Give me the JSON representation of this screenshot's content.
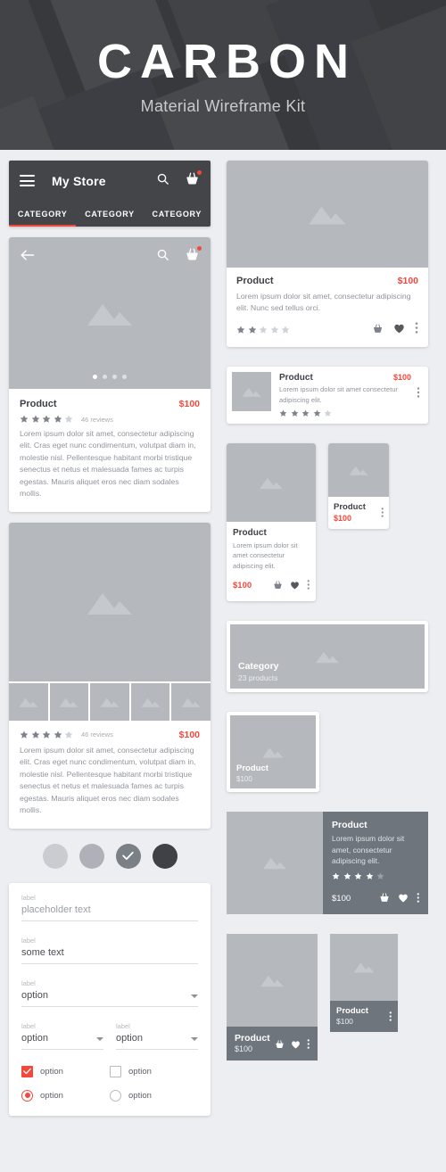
{
  "hero": {
    "title": "CARBON",
    "subtitle": "Material Wireframe Kit"
  },
  "colors": {
    "accent_red": "#f4483d",
    "appbar_dark": "#434549",
    "placeholder_gray": "#b5b8bd",
    "panel_gray": "#6e757c",
    "page_bg": "#edeef2"
  },
  "appbar": {
    "title": "My Store",
    "menu_icon": "hamburger-icon",
    "search_icon": "search-icon",
    "cart_icon": "cart-icon",
    "tabs": [
      {
        "label": "CATEGORY",
        "active": true
      },
      {
        "label": "CATEGORY",
        "active": false
      },
      {
        "label": "CATEGORY",
        "active": false
      }
    ]
  },
  "detail_card": {
    "back_icon": "back-arrow-icon",
    "search_icon": "search-icon",
    "cart_icon": "cart-icon",
    "carousel_dots": 4,
    "carousel_active": 1,
    "name": "Product",
    "price": "$100",
    "rating": 4,
    "reviews": "46 reviews",
    "description": "Lorem ipsum dolor sit amet, consectetur adipiscing elit. Cras eget nunc condimentum, volutpat diam in, molestie nisl. Pellentesque habitant morbi tristique senectus et netus et malesuada fames ac turpis egestas. Mauris aliquet eros nec diam sodales mollis."
  },
  "gallery_card": {
    "thumbnail_count": 5,
    "rating": 4,
    "reviews": "46 reviews",
    "price": "$100",
    "description": "Lorem ipsum dolor sit amet, consectetur adipiscing elit. Cras eget nunc condimentum, volutpat diam in, molestie nisl. Pellentesque habitant morbi tristique senectus et netus et malesuada fames ac turpis egestas. Mauris aliquet eros nec diam sodales mollis."
  },
  "swatches": [
    {
      "name": "swatch-lightest",
      "color": "#c9ccd1",
      "selected": false
    },
    {
      "name": "swatch-light",
      "color": "#aeb2b8",
      "selected": false
    },
    {
      "name": "swatch-medium",
      "color": "#7b7f86",
      "selected": true
    },
    {
      "name": "swatch-dark",
      "color": "#3e4146",
      "selected": false
    }
  ],
  "form": {
    "text_field": {
      "label": "label",
      "value": "placeholder text",
      "is_placeholder": true
    },
    "text_field_filled": {
      "label": "label",
      "value": "some text",
      "is_placeholder": false
    },
    "select_full": {
      "label": "label",
      "value": "option"
    },
    "select_left": {
      "label": "label",
      "value": "option"
    },
    "select_right": {
      "label": "label",
      "value": "option"
    },
    "checkbox_checked": {
      "label": "option",
      "checked": true
    },
    "checkbox_unchecked": {
      "label": "option",
      "checked": false
    },
    "radio_selected": {
      "label": "option",
      "selected": true
    },
    "radio_unselected": {
      "label": "option",
      "selected": false
    }
  },
  "right_column": {
    "card_full": {
      "name": "Product",
      "price": "$100",
      "description": "Lorem ipsum dolor sit amet, consectetur adipiscing elit. Nunc sed tellus orci.",
      "rating": 2,
      "actions": [
        "cart-icon",
        "heart-icon",
        "overflow-menu-icon"
      ]
    },
    "card_list": {
      "name": "Product",
      "price": "$100",
      "description": "Lorem ipsum dolor sit amet consectetur adipiscing elit.",
      "rating": 4,
      "actions": [
        "overflow-menu-icon"
      ]
    },
    "card_grid_large": {
      "name": "Product",
      "price": "$100",
      "description": "Lorem ipsum dolor sit amet consectetur adipiscing elit.",
      "actions": [
        "cart-icon",
        "heart-icon",
        "overflow-menu-icon"
      ]
    },
    "card_grid_small": {
      "name": "Product",
      "price": "$100",
      "actions": [
        "overflow-menu-icon"
      ]
    },
    "card_category": {
      "name": "Category",
      "subtitle": "23 products"
    },
    "card_overlay": {
      "name": "Product",
      "price": "$100"
    },
    "card_split": {
      "name": "Product",
      "description": "Lorem ipsum dolor sit amet, consectetur adipiscing elit.",
      "rating": 4,
      "price": "$100",
      "actions": [
        "cart-icon",
        "heart-icon",
        "overflow-menu-icon"
      ]
    },
    "card_darkfooter_large": {
      "name": "Product",
      "price": "$100",
      "actions": [
        "cart-icon",
        "heart-icon",
        "overflow-menu-icon"
      ]
    },
    "card_darkfooter_small": {
      "name": "Product",
      "price": "$100",
      "actions": [
        "overflow-menu-icon"
      ]
    }
  }
}
